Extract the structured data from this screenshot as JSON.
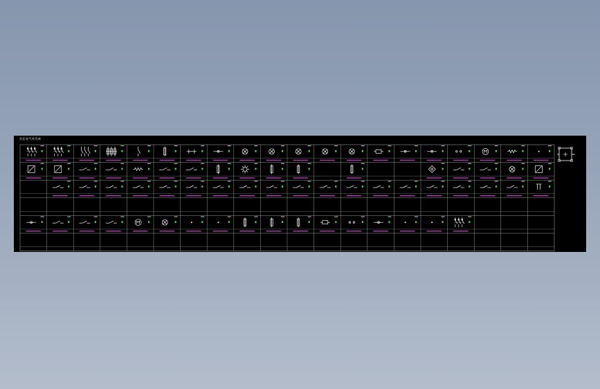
{
  "colors": {
    "background": "#000000",
    "grid_line": "#9a9a9a",
    "symbol": "#ffffff",
    "label_magenta": "#d24bd2",
    "code_green": "#39e639",
    "window_background": "#8e9cb2"
  },
  "sheet": {
    "title": "台区电气符号库"
  },
  "grid": {
    "rows": 6,
    "cols": 20
  },
  "symbols": [
    "breaker-3p",
    "breaker-3p",
    "switch-3p",
    "fuse-3p",
    "disconnector",
    "fuse",
    "transformer",
    "contact",
    "lamp",
    "lamp",
    "lamp",
    "lamp",
    "lamp",
    "coil",
    "contact",
    "contact",
    "terminal",
    "motor",
    "resistor",
    "node",
    "meter",
    "meter",
    "switch-no",
    "switch-no",
    "resistor",
    "switch-no",
    "switch-no",
    "fuse",
    "lamp-star",
    "fuse",
    "fuse",
    "",
    "fuse",
    "",
    "",
    "diamond",
    "switch-no",
    "switch-no",
    "lamp",
    "meter",
    "",
    "switch-no",
    "switch-no",
    "switch-no",
    "switch-no",
    "switch-no",
    "switch-no",
    "switch-no",
    "switch-no",
    "switch-no",
    "switch-no",
    "switch-no",
    "switch-no",
    "switch-no",
    "switch-no",
    "switch-no",
    "switch-no",
    "switch-no",
    "switch-no",
    "switch-nc",
    "",
    "",
    "",
    "",
    "",
    "",
    "",
    "",
    "",
    "",
    "",
    "",
    "",
    "",
    "",
    "",
    "",
    "",
    "",
    "",
    "contact",
    "switch-no",
    "switch-no",
    "switch-no",
    "motor",
    "lamp",
    "node",
    "node",
    "fuse",
    "fuse",
    "fuse",
    "coil",
    "terminal",
    "contact",
    "node",
    "node",
    "breaker-3p",
    "",
    "",
    "",
    "",
    "",
    "",
    "",
    "",
    "",
    "",
    "",
    "",
    "",
    "",
    "",
    "",
    "",
    "",
    "",
    "",
    "",
    "",
    ""
  ]
}
